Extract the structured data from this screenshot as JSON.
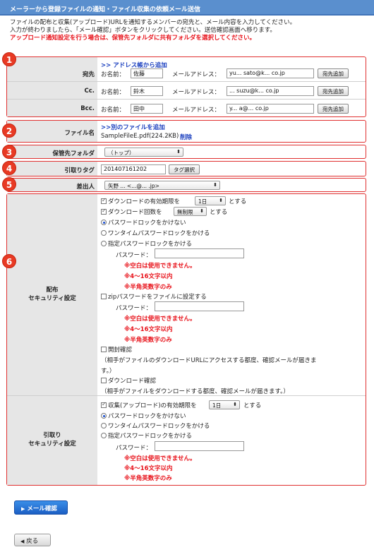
{
  "title": "メーラーから登録ファイルの通知・ファイル収集の依頼メール送信",
  "intro": {
    "line1": "ファイルの配布と収集(アップロード)URLを通知するメンバーの宛先と、メール内容を入力してください。",
    "line2": "入力が終わりましたら、「メール確認」ボタンをクリックしてください。送信確認画面へ移ります。",
    "warning": "アップロード通知設定を行う場合は、保管先フォルダに共有フォルダを選択してください。"
  },
  "badges": [
    "1",
    "2",
    "3",
    "4",
    "5",
    "6"
  ],
  "recipients": {
    "address_book_link": ">> アドレス帳から追加",
    "name_label": "お名前：",
    "email_label": "メールアドレス：",
    "add_button": "宛先追加",
    "rows": [
      {
        "label": "宛先",
        "name": "佐藤",
        "email": "yu... sato@k... co.jp"
      },
      {
        "label": "Cc.",
        "name": "鈴木",
        "email": "... suzu@k... co.jp"
      },
      {
        "label": "Bcc.",
        "name": "田中",
        "email": "y... a@... co.jp"
      }
    ]
  },
  "file": {
    "label": "ファイル名",
    "add_link": ">>別のファイルを追加",
    "filename": "SampleFileE.pdf(224.2KB)",
    "delete": "削除"
  },
  "folder": {
    "label": "保管先フォルダ",
    "value": "（トップ）"
  },
  "tag": {
    "label": "引取りタグ",
    "value": "201407161202",
    "button": "タグ選択"
  },
  "sender": {
    "label": "差出人",
    "value": "矢野 ... <...@... .jp>"
  },
  "dist": {
    "label_line1": "配布",
    "label_line2": "セキュリティ設定",
    "expiry_prefix": "ダウンロードの有効期限を",
    "expiry_value": "1日",
    "expiry_suffix": "とする",
    "count_prefix": "ダウンロード回数を",
    "count_value": "無制限",
    "count_suffix": "とする",
    "opt_nolock": "パスワードロックをかけない",
    "opt_onetime": "ワンタイムパスワードロックをかける",
    "opt_specified": "指定パスワードロックをかける",
    "password_label": "パスワード：",
    "rule1": "※空白は使用できません。",
    "rule2": "※4〜16文字以内",
    "rule3": "※半角英数字のみ",
    "zip_label": "zipパスワードをファイルに設定する",
    "open_confirm": "開封確認",
    "open_note1": "（相手がファイルのダウンロードURLにアクセスする都度、確認メールが届きま",
    "open_note2": "す。）",
    "dl_confirm": "ダウンロード確認",
    "dl_note": "（相手がファイルをダウンロードする都度、確認メールが届きます。）"
  },
  "collect": {
    "label_line1": "引取り",
    "label_line2": "セキュリティ設定",
    "expiry_prefix": "収集(アップロード)の有効期限を",
    "expiry_value": "1日",
    "expiry_suffix": "とする",
    "opt_nolock": "パスワードロックをかけない",
    "opt_onetime": "ワンタイムパスワードロックをかける",
    "opt_specified": "指定パスワードロックをかける",
    "password_label": "パスワード：",
    "rule1": "※空白は使用できません。",
    "rule2": "※4〜16文字以内",
    "rule3": "※半角英数字のみ"
  },
  "buttons": {
    "mail_confirm": "メール確認",
    "back": "戻る"
  },
  "colors": {
    "title_bar": "#5a8fce",
    "warning": "#e8131b",
    "badge": "#e83a24",
    "section_border": "#e03030",
    "primary_button": "#1c5fc4"
  }
}
